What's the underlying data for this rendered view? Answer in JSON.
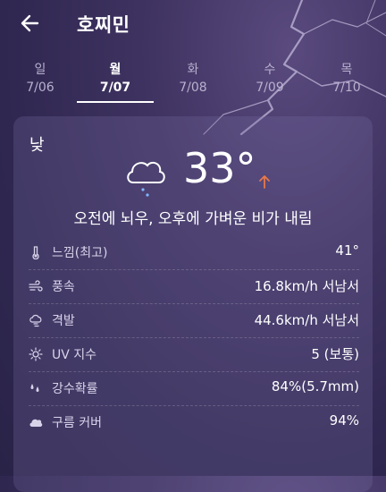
{
  "header": {
    "city": "호찌민"
  },
  "tabs": [
    {
      "day": "일",
      "date": "7/06"
    },
    {
      "day": "월",
      "date": "7/07"
    },
    {
      "day": "화",
      "date": "7/08"
    },
    {
      "day": "수",
      "date": "7/09"
    },
    {
      "day": "목",
      "date": "7/10"
    }
  ],
  "active_tab": "월",
  "card": {
    "period": "낮",
    "temperature": "33°",
    "summary": "오전에 뇌우, 오후에 가벼운 비가 내림",
    "details": [
      {
        "icon": "thermometer-icon",
        "label": "느낌(최고)",
        "value": "41°"
      },
      {
        "icon": "wind-icon",
        "label": "풍속",
        "value": "16.8km/h 서남서"
      },
      {
        "icon": "gust-icon",
        "label": "격발",
        "value": "44.6km/h 서남서"
      },
      {
        "icon": "sun-icon",
        "label": "UV 지수",
        "value": "5 (보통)"
      },
      {
        "icon": "raindrops-icon",
        "label": "강수확률",
        "value": "84%(5.7mm)"
      },
      {
        "icon": "cloud-icon",
        "label": "구름 커버",
        "value": "94%"
      }
    ]
  },
  "colors": {
    "arrow": "#e8784a",
    "accent": "#ffffff",
    "background": "#3a2f5c"
  }
}
